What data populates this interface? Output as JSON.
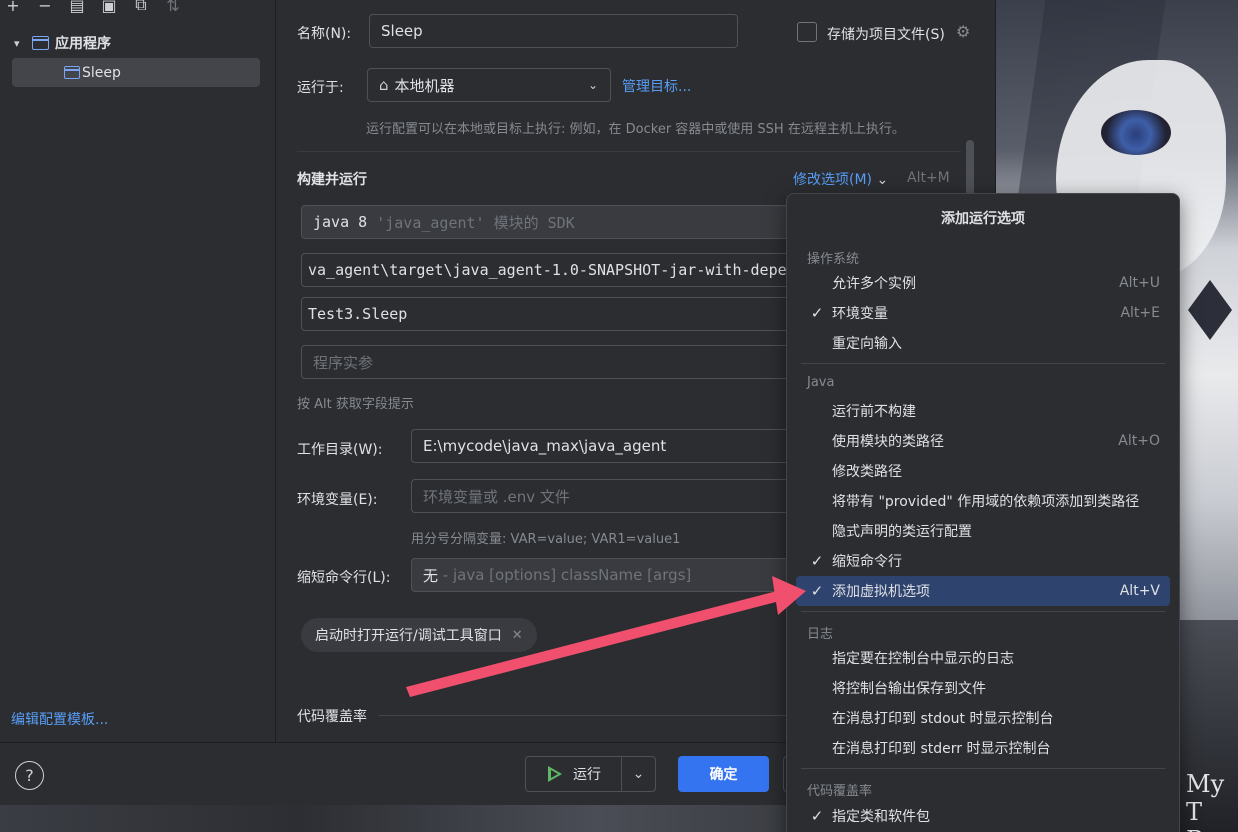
{
  "left_panel": {
    "toolbar_icons": [
      "plus-icon",
      "minus-icon",
      "copy-icon",
      "save-icon",
      "folder-add-icon",
      "sort-icon"
    ],
    "tree_root": "应用程序",
    "tree_child": "Sleep",
    "edit_templates": "编辑配置模板..."
  },
  "form": {
    "name_label": "名称(N):",
    "name_value": "Sleep",
    "store_as_project_file": "存储为项目文件(S)",
    "run_on_label": "运行于:",
    "run_on_value": "本地机器",
    "manage_targets": "管理目标...",
    "run_on_hint": "运行配置可以在本地或目标上执行: 例如，在 Docker 容器中或使用 SSH 在远程主机上执行。",
    "build_run_title": "构建并运行",
    "modify_options": "修改选项(M)",
    "modify_shortcut": "Alt+M",
    "sdk_value": "java 8",
    "sdk_hint": "'java_agent' 模块的 SDK",
    "jar_value": "va_agent\\target\\java_agent-1.0-SNAPSHOT-jar-with-depen",
    "main_class": "Test3.Sleep",
    "program_args_placeholder": "程序实参",
    "alt_hint": "按 Alt 获取字段提示",
    "workdir_label": "工作目录(W):",
    "workdir_value": "E:\\mycode\\java_max\\java_agent",
    "env_label": "环境变量(E):",
    "env_placeholder": "环境变量或 .env 文件",
    "env_hint": "用分号分隔变量: VAR=value; VAR1=value1",
    "shorten_label": "缩短命令行(L):",
    "shorten_value": "无",
    "shorten_hint": "- java [options] className [args]",
    "chip_label": "启动时打开运行/调试工具窗口",
    "coverage_title": "代码覆盖率"
  },
  "footer": {
    "help": "?",
    "run": "运行",
    "ok": "确定"
  },
  "popup": {
    "title": "添加运行选项",
    "groups": [
      {
        "name": "操作系统",
        "items": [
          {
            "label": "允许多个实例",
            "shortcut": "Alt+U",
            "checked": false
          },
          {
            "label": "环境变量",
            "shortcut": "Alt+E",
            "checked": true
          },
          {
            "label": "重定向输入",
            "shortcut": "",
            "checked": false
          }
        ]
      },
      {
        "name": "Java",
        "items": [
          {
            "label": "运行前不构建",
            "shortcut": "",
            "checked": false
          },
          {
            "label": "使用模块的类路径",
            "shortcut": "Alt+O",
            "checked": false
          },
          {
            "label": "修改类路径",
            "shortcut": "",
            "checked": false
          },
          {
            "label": "将带有 \"provided\" 作用域的依赖项添加到类路径",
            "shortcut": "",
            "checked": false
          },
          {
            "label": "隐式声明的类运行配置",
            "shortcut": "",
            "checked": false
          },
          {
            "label": "缩短命令行",
            "shortcut": "",
            "checked": true
          },
          {
            "label": "添加虚拟机选项",
            "shortcut": "Alt+V",
            "checked": true,
            "selected": true
          }
        ]
      },
      {
        "name": "日志",
        "items": [
          {
            "label": "指定要在控制台中显示的日志",
            "shortcut": "",
            "checked": false
          },
          {
            "label": "将控制台输出保存到文件",
            "shortcut": "",
            "checked": false
          },
          {
            "label": "在消息打印到 stdout 时显示控制台",
            "shortcut": "",
            "checked": false
          },
          {
            "label": "在消息打印到 stderr 时显示控制台",
            "shortcut": "",
            "checked": false
          }
        ]
      },
      {
        "name": "代码覆盖率",
        "items": [
          {
            "label": "指定类和软件包",
            "shortcut": "",
            "checked": true
          }
        ]
      }
    ]
  },
  "wallpaper": {
    "text_line1": "My T",
    "text_line2": "Ro"
  },
  "colors": {
    "accent": "#3574f0",
    "link": "#589df6",
    "selection": "#2e436e",
    "arrow": "#f0506e"
  }
}
